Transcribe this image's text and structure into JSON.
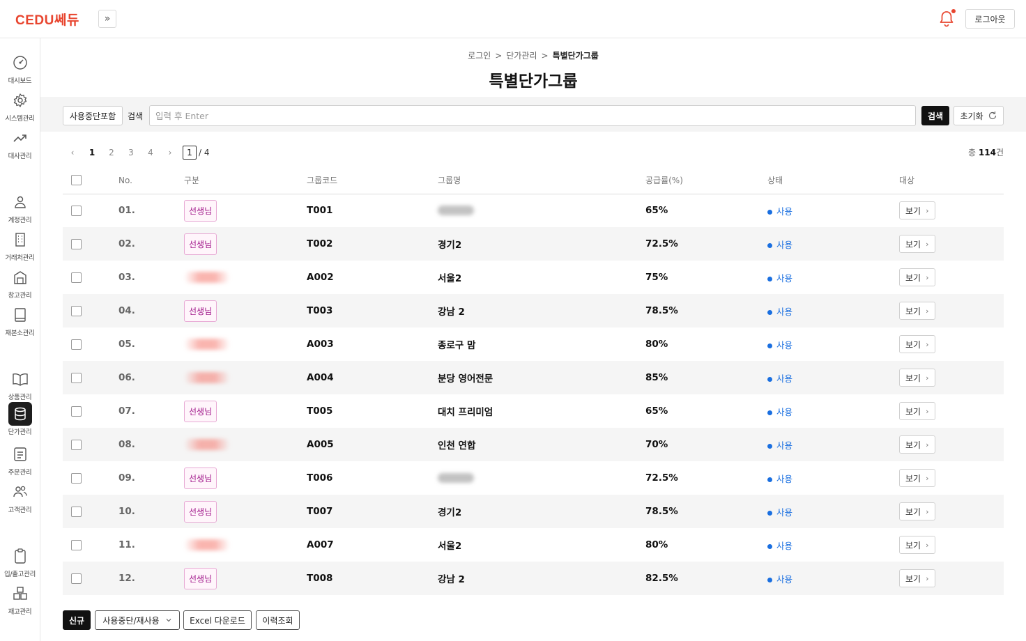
{
  "brand": {
    "logo": "CEDU쎄듀",
    "accent": "#e8452f"
  },
  "topbar": {
    "expand_icon": "»",
    "logout_label": "로그아웃"
  },
  "sidebar": {
    "items": [
      {
        "label": "대시보드",
        "icon": "dashboard-icon"
      },
      {
        "label": "시스템관리",
        "icon": "gear-icon"
      },
      {
        "label": "대사관리",
        "icon": "trend-icon"
      },
      {
        "label": "계정관리",
        "icon": "user-icon"
      },
      {
        "label": "거래처관리",
        "icon": "building-icon"
      },
      {
        "label": "창고관리",
        "icon": "warehouse-icon"
      },
      {
        "label": "재본소관리",
        "icon": "book-icon"
      },
      {
        "label": "상품관리",
        "icon": "open-book-icon"
      },
      {
        "label": "단가관리",
        "icon": "database-icon",
        "active": true
      },
      {
        "label": "주문관리",
        "icon": "list-icon"
      },
      {
        "label": "고객관리",
        "icon": "users-icon"
      },
      {
        "label": "입/출고관리",
        "icon": "clipboard-icon"
      },
      {
        "label": "재고관리",
        "icon": "boxes-icon"
      }
    ]
  },
  "breadcrumb": {
    "items": [
      "로그인",
      "단가관리",
      "특별단가그룹"
    ],
    "separator": ">"
  },
  "page_title": "특별단가그룹",
  "search": {
    "include_stopped_label": "사용중단포함",
    "label": "검색",
    "placeholder": "입력 후 Enter",
    "search_button": "검색",
    "reset_button": "초기화"
  },
  "pagination": {
    "pages": [
      "1",
      "2",
      "3",
      "4"
    ],
    "current": "1",
    "total_pages": "/ 4",
    "prev": "‹",
    "next": "›"
  },
  "total": {
    "prefix": "총",
    "count": "114",
    "suffix": "건"
  },
  "table": {
    "headers": [
      "No.",
      "구분",
      "그룹코드",
      "그룹명",
      "공급률(%)",
      "상태",
      "대상"
    ],
    "rows": [
      {
        "no": "01.",
        "type": "선생님",
        "code": "T001",
        "name": "",
        "rate": "65%",
        "status": "사용",
        "action": "보기"
      },
      {
        "no": "02.",
        "type": "선생님",
        "code": "T002",
        "name": "경기2",
        "rate": "72.5%",
        "status": "사용",
        "action": "보기"
      },
      {
        "no": "03.",
        "type": "",
        "code": "A002",
        "name": "서울2",
        "rate": "75%",
        "status": "사용",
        "action": "보기"
      },
      {
        "no": "04.",
        "type": "선생님",
        "code": "T003",
        "name": "강남 2",
        "rate": "78.5%",
        "status": "사용",
        "action": "보기"
      },
      {
        "no": "05.",
        "type": "",
        "code": "A003",
        "name": "종로구 맘",
        "rate": "80%",
        "status": "사용",
        "action": "보기"
      },
      {
        "no": "06.",
        "type": "",
        "code": "A004",
        "name": "분당 영어전문",
        "rate": "85%",
        "status": "사용",
        "action": "보기"
      },
      {
        "no": "07.",
        "type": "선생님",
        "code": "T005",
        "name": "대치 프리미엄",
        "rate": "65%",
        "status": "사용",
        "action": "보기"
      },
      {
        "no": "08.",
        "type": "",
        "code": "A005",
        "name": "인천 연합",
        "rate": "70%",
        "status": "사용",
        "action": "보기"
      },
      {
        "no": "09.",
        "type": "선생님",
        "code": "T006",
        "name": "",
        "rate": "72.5%",
        "status": "사용",
        "action": "보기"
      },
      {
        "no": "10.",
        "type": "선생님",
        "code": "T007",
        "name": "경기2",
        "rate": "78.5%",
        "status": "사용",
        "action": "보기"
      },
      {
        "no": "11.",
        "type": "",
        "code": "A007",
        "name": "서울2",
        "rate": "80%",
        "status": "사용",
        "action": "보기"
      },
      {
        "no": "12.",
        "type": "선생님",
        "code": "T008",
        "name": "강남 2",
        "rate": "82.5%",
        "status": "사용",
        "action": "보기"
      }
    ]
  },
  "bottom": {
    "new_label": "신규",
    "toggle_label": "사용중단/재사용",
    "excel_label": "Excel 다운로드",
    "history_label": "이력조회"
  }
}
